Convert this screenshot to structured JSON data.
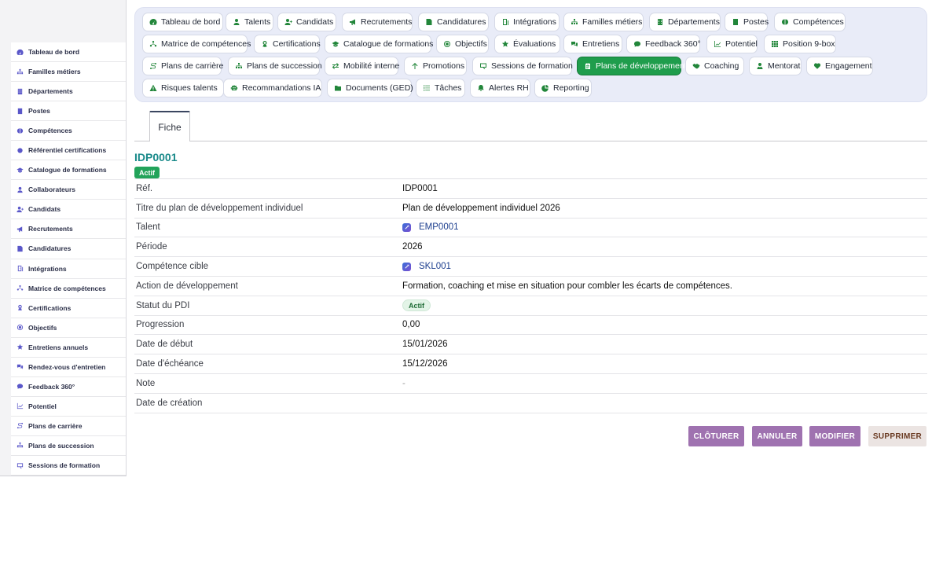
{
  "sidebar": {
    "items": [
      {
        "label": "Tableau de bord",
        "icon": "dashboard-icon"
      },
      {
        "label": "Familles métiers",
        "icon": "sitemap-icon"
      },
      {
        "label": "Départements",
        "icon": "building-icon"
      },
      {
        "label": "Postes",
        "icon": "id-card-icon"
      },
      {
        "label": "Compétences",
        "icon": "brain-icon"
      },
      {
        "label": "Référentiel certifications",
        "icon": "certificate-icon"
      },
      {
        "label": "Catalogue de formations",
        "icon": "graduation-cap-icon"
      },
      {
        "label": "Collaborateurs",
        "icon": "user-icon"
      },
      {
        "label": "Candidats",
        "icon": "user-plus-icon"
      },
      {
        "label": "Recrutements",
        "icon": "megaphone-icon"
      },
      {
        "label": "Candidatures",
        "icon": "file-signature-icon"
      },
      {
        "label": "Intégrations",
        "icon": "door-icon"
      },
      {
        "label": "Matrice de compétences",
        "icon": "network-icon"
      },
      {
        "label": "Certifications",
        "icon": "award-icon"
      },
      {
        "label": "Objectifs",
        "icon": "target-icon"
      },
      {
        "label": "Entretiens annuels",
        "icon": "star-icon"
      },
      {
        "label": "Rendez-vous d'entretien",
        "icon": "comments-icon"
      },
      {
        "label": "Feedback 360°",
        "icon": "comment-dots-icon"
      },
      {
        "label": "Potentiel",
        "icon": "chart-line-icon"
      },
      {
        "label": "Plans de carrière",
        "icon": "route-icon"
      },
      {
        "label": "Plans de succession",
        "icon": "sitemap-icon"
      },
      {
        "label": "Sessions de formation",
        "icon": "chalkboard-icon"
      }
    ]
  },
  "topnav": {
    "items": [
      {
        "label": "Tableau de bord",
        "icon": "dashboard-icon"
      },
      {
        "label": "Talents",
        "icon": "user-icon"
      },
      {
        "label": "Candidats",
        "icon": "user-plus-icon"
      },
      {
        "label": "Recrutements",
        "icon": "megaphone-icon"
      },
      {
        "label": "Candidatures",
        "icon": "file-signature-icon"
      },
      {
        "label": "Intégrations",
        "icon": "door-icon"
      },
      {
        "label": "Familles métiers",
        "icon": "sitemap-icon"
      },
      {
        "label": "Départements",
        "icon": "building-icon"
      },
      {
        "label": "Postes",
        "icon": "id-card-icon"
      },
      {
        "label": "Compétences",
        "icon": "brain-icon"
      },
      {
        "label": "Matrice de compétences",
        "icon": "network-icon"
      },
      {
        "label": "Certifications",
        "icon": "award-icon"
      },
      {
        "label": "Catalogue de formations",
        "icon": "graduation-cap-icon"
      },
      {
        "label": "Objectifs",
        "icon": "target-icon"
      },
      {
        "label": "Évaluations",
        "icon": "star-icon"
      },
      {
        "label": "Entretiens",
        "icon": "comments-icon"
      },
      {
        "label": "Feedback 360°",
        "icon": "comment-dots-icon"
      },
      {
        "label": "Potentiel",
        "icon": "chart-line-icon"
      },
      {
        "label": "Position 9-box",
        "icon": "grid-icon"
      },
      {
        "label": "Plans de carrière",
        "icon": "route-icon"
      },
      {
        "label": "Plans de succession",
        "icon": "sitemap-icon"
      },
      {
        "label": "Mobilité interne",
        "icon": "exchange-icon"
      },
      {
        "label": "Promotions",
        "icon": "arrow-up-icon"
      },
      {
        "label": "Sessions de formation",
        "icon": "chalkboard-icon"
      },
      {
        "label": "Plans de développement",
        "icon": "clipboard-icon",
        "active": true
      },
      {
        "label": "Coaching",
        "icon": "handshake-icon"
      },
      {
        "label": "Mentorat",
        "icon": "user-tie-icon"
      },
      {
        "label": "Engagement",
        "icon": "heart-icon"
      },
      {
        "label": "Risques talents",
        "icon": "warning-icon"
      },
      {
        "label": "Recommandations IA",
        "icon": "robot-icon"
      },
      {
        "label": "Documents (GED)",
        "icon": "folder-icon"
      },
      {
        "label": "Tâches",
        "icon": "tasks-icon"
      },
      {
        "label": "Alertes RH",
        "icon": "bell-icon"
      },
      {
        "label": "Reporting",
        "icon": "pie-chart-icon"
      }
    ]
  },
  "tabs": {
    "fiche": "Fiche"
  },
  "record": {
    "id": "IDP0001",
    "status": "Actif"
  },
  "fields": {
    "ref": {
      "label": "Réf.",
      "value": "IDP0001"
    },
    "title": {
      "label": "Titre du plan de développement individuel",
      "value": "Plan de développement individuel 2026"
    },
    "talent": {
      "label": "Talent",
      "value": "EMP0001"
    },
    "period": {
      "label": "Période",
      "value": "2026"
    },
    "skill": {
      "label": "Compétence cible",
      "value": "SKL001"
    },
    "action": {
      "label": "Action de développement",
      "value": "Formation, coaching et mise en situation pour combler les écarts de compétences."
    },
    "status": {
      "label": "Statut du PDI",
      "value": "Actif"
    },
    "progress": {
      "label": "Progression",
      "value": "0,00"
    },
    "start": {
      "label": "Date de début",
      "value": "15/01/2026"
    },
    "due": {
      "label": "Date d'échéance",
      "value": "15/12/2026"
    },
    "note": {
      "label": "Note",
      "value": "-"
    },
    "created": {
      "label": "Date de création",
      "value": ""
    }
  },
  "actions": {
    "close": "CLÔTURER",
    "cancel": "ANNULER",
    "edit": "MODIFIER",
    "delete": "SUPPRIMER"
  },
  "colors": {
    "accent_green": "#1f9d4c",
    "record_id": "#1a8a8a",
    "action_purple": "#9f72b0",
    "sidebar_icon": "#5a57c9"
  }
}
